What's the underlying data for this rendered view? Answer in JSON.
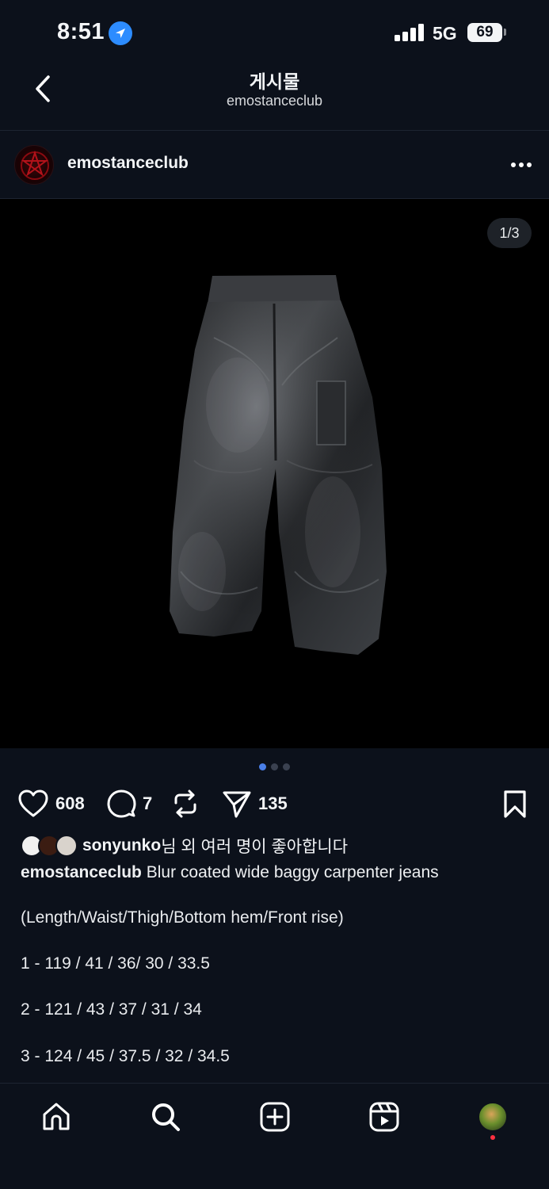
{
  "status_bar": {
    "time": "8:51",
    "network": "5G",
    "battery": "69"
  },
  "header": {
    "title": "게시물",
    "subtitle": "emostanceclub"
  },
  "post": {
    "username": "emostanceclub",
    "media_counter": "1/3",
    "carousel": {
      "total": 3,
      "active_index": 0
    },
    "likes_count": "608",
    "comments_count": "7",
    "shares_count": "135",
    "liked_by_user": "sonyunko",
    "liked_by_suffix": "님 외 여러 명이 좋아합니다",
    "caption_user": "emostanceclub",
    "caption_text": " Blur coated wide baggy carpenter jeans",
    "caption_lines": [
      "(Length/Waist/Thigh/Bottom hem/Front rise)",
      "1 - 119 / 41 / 36/ 30 / 33.5",
      "2 - 121 / 43 / 37 / 31 / 34",
      "3 - 124 / 45 / 37.5 / 32 / 34.5"
    ]
  },
  "icons": {
    "back": "chevron-left-icon",
    "location": "location-arrow-icon",
    "more": "more-horizontal-icon",
    "like": "heart-icon",
    "comment": "comment-bubble-icon",
    "repost": "repost-icon",
    "share": "send-icon",
    "save": "bookmark-icon",
    "nav": [
      "home-icon",
      "search-icon",
      "create-icon",
      "reels-icon",
      "profile-avatar"
    ]
  },
  "colors": {
    "background": "#0c111b",
    "accent": "#2d8cff",
    "dot_active": "#4a7fe8",
    "notification": "#ff3040"
  }
}
